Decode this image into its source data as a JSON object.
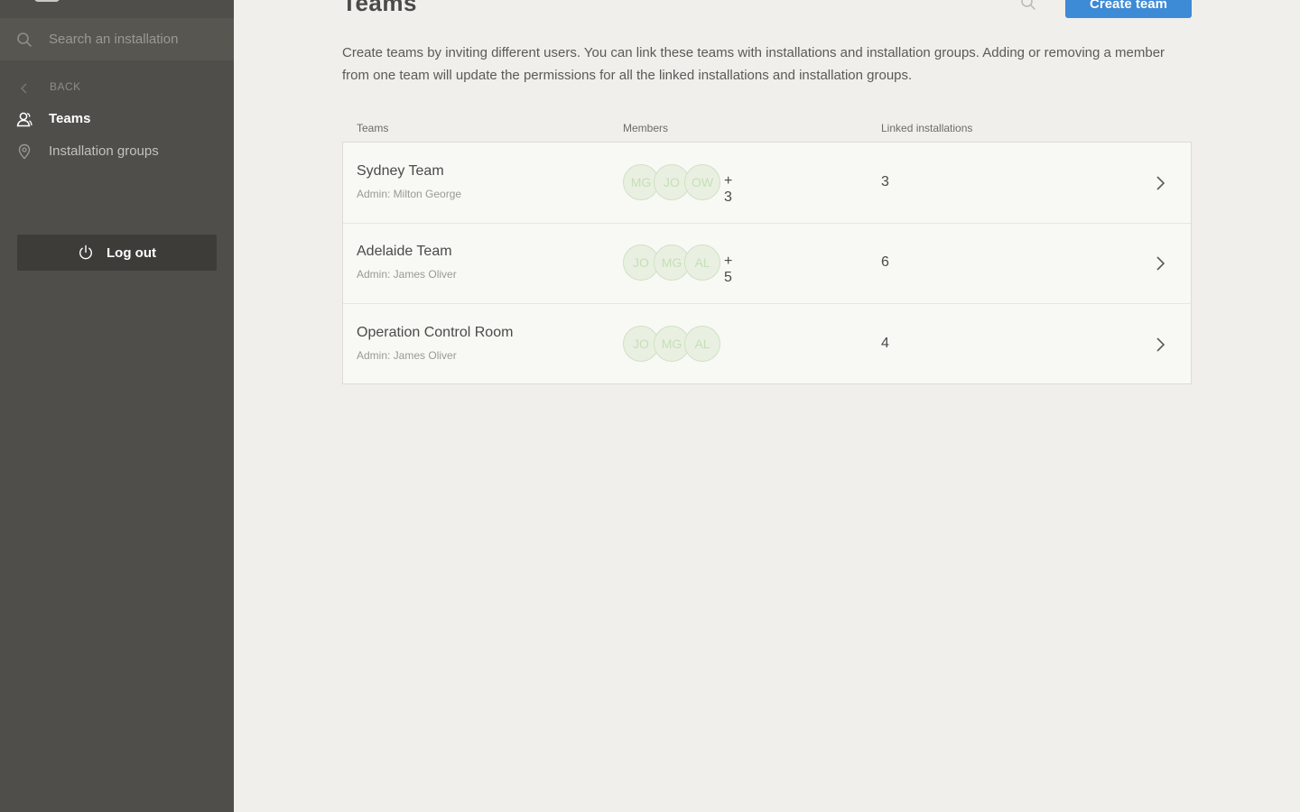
{
  "sidebar": {
    "search": {
      "placeholder": "Search an installation",
      "icon": "search-icon"
    },
    "back": {
      "label": "BACK",
      "icon": "chevron-left-icon"
    },
    "items": [
      {
        "label": "Teams",
        "icon": "users-icon",
        "active": true
      },
      {
        "label": "Installation groups",
        "icon": "location-pin-icon",
        "active": false
      }
    ],
    "logout": {
      "label": "Log out",
      "icon": "power-icon"
    }
  },
  "header": {
    "title": "Teams",
    "create_label": "Create team"
  },
  "description": "Create teams by inviting different users. You can link these teams with installations and installation groups. Adding or removing a member from one team will update the permissions for all the linked installations and installation groups.",
  "table": {
    "columns": [
      "Teams",
      "Members",
      "Linked installations"
    ],
    "rows": [
      {
        "name": "Sydney Team",
        "admin": "Admin: Milton George",
        "avatars": [
          "MG",
          "JO",
          "OW"
        ],
        "extra": "+ 3",
        "linked": "3"
      },
      {
        "name": "Adelaide Team",
        "admin": "Admin: James Oliver",
        "avatars": [
          "JO",
          "MG",
          "AL"
        ],
        "extra": "+ 5",
        "linked": "6"
      },
      {
        "name": "Operation Control Room",
        "admin": "Admin: James Oliver",
        "avatars": [
          "JO",
          "MG",
          "AL"
        ],
        "extra": "",
        "linked": "4"
      }
    ]
  },
  "colors": {
    "sidebar_bg": "#4f4e4a",
    "main_bg": "#f0efeb",
    "accent": "#3d8ad6",
    "avatar_text": "#c6dfb6"
  }
}
